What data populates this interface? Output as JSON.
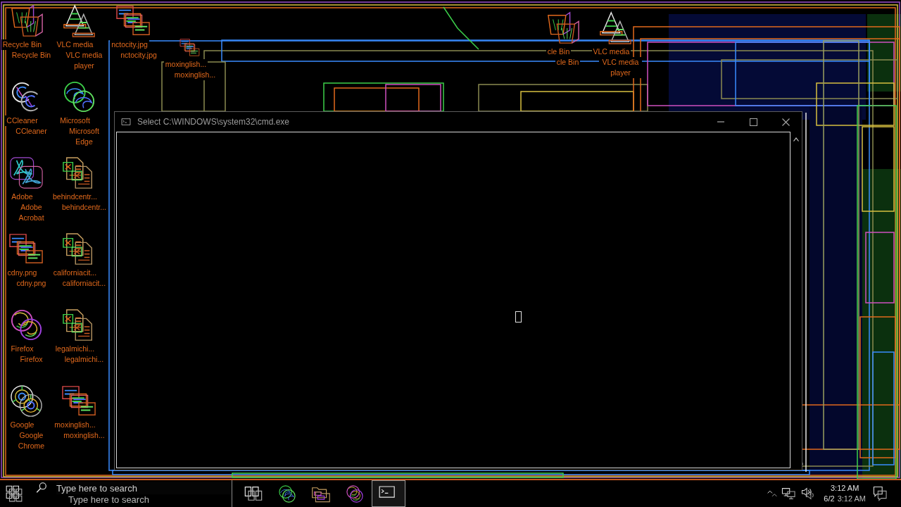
{
  "desktop": {
    "icons": [
      {
        "kind": "bin",
        "echo": "Recycle Bin",
        "label": "Recycle Bin"
      },
      {
        "kind": "cone",
        "echo": "VLC media",
        "label": "VLC media player"
      },
      {
        "kind": "image",
        "echo": "nctocity.jpg",
        "label": "nctocity.jpg"
      },
      {
        "kind": "image",
        "echo": "moxinglish...",
        "label": "moxinglish..."
      },
      {
        "kind": "swirl",
        "echo": "CCleaner",
        "label": "CCleaner"
      },
      {
        "kind": "wave",
        "echo": "Microsoft",
        "label": "Microsoft Edge"
      },
      {
        "kind": "loop",
        "echo": "Adobe",
        "label": "Adobe Acrobat"
      },
      {
        "kind": "sheet",
        "echo": "behindcentr...",
        "label": "behindcentr..."
      },
      {
        "kind": "image",
        "echo": "cdny.png",
        "label": "cdny.png"
      },
      {
        "kind": "sheet",
        "echo": "californiacit...",
        "label": "californiacit..."
      },
      {
        "kind": "orb",
        "echo": "Firefox",
        "label": "Firefox"
      },
      {
        "kind": "sheet",
        "echo": "legalmichi...",
        "label": "legalmichi..."
      },
      {
        "kind": "rings",
        "echo": "Google",
        "label": "Google Chrome"
      },
      {
        "kind": "image",
        "echo": "moxinglish...",
        "label": "moxinglish..."
      }
    ]
  },
  "desktop_fragment": {
    "icons": [
      {
        "kind": "bin",
        "echo": "cle Bin",
        "label": "cle Bin"
      },
      {
        "kind": "cone",
        "echo": "VLC media",
        "label": "VLC media player"
      }
    ]
  },
  "window": {
    "title": "Select C:\\WINDOWS\\system32\\cmd.exe"
  },
  "taskbar": {
    "search": {
      "placeholder": "Type here to search",
      "echo": "Type here to search"
    },
    "apps": [
      {
        "kind": "taskview",
        "selected": false
      },
      {
        "kind": "wave",
        "selected": false
      },
      {
        "kind": "folder",
        "selected": false
      },
      {
        "kind": "orb",
        "selected": false
      },
      {
        "kind": "console",
        "selected": true
      }
    ],
    "clock": {
      "time": "3:12 AM",
      "date": "6/2",
      "echo_time": "3:12 AM"
    }
  }
}
